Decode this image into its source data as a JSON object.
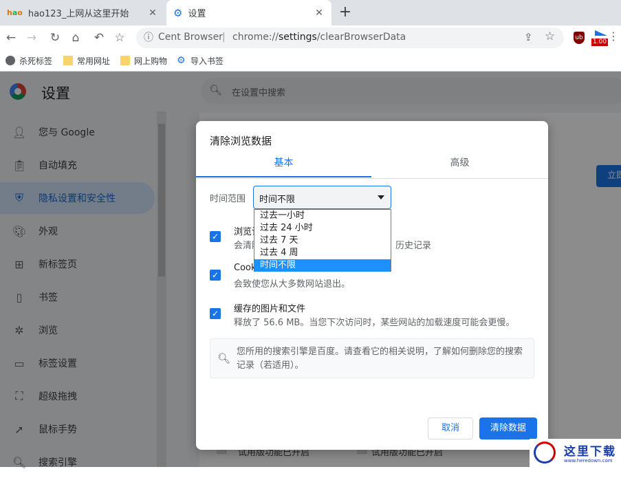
{
  "tabs": [
    {
      "title": "hao123_上网从这里开始",
      "icon": "hao123-favicon"
    },
    {
      "title": "设置",
      "icon": "gear-icon"
    }
  ],
  "toolbar": {
    "brand": "Cent Browser",
    "separator": "|",
    "url_prefix": "chrome://",
    "url_host": "settings",
    "url_path": "/clearBrowserData",
    "extension_badge": "1.00"
  },
  "bookmarks": [
    {
      "label": "杀死标签",
      "icon": "kill-tab-icon"
    },
    {
      "label": "常用网址",
      "icon": "folder-icon"
    },
    {
      "label": "网上购物",
      "icon": "folder-icon"
    },
    {
      "label": "导入书签",
      "icon": "gear-icon"
    }
  ],
  "settings": {
    "title": "设置",
    "search_placeholder": "在设置中搜索",
    "nav": [
      {
        "label": "您与 Google",
        "icon": "person-icon"
      },
      {
        "label": "自动填充",
        "icon": "clipboard-icon"
      },
      {
        "label": "隐私设置和安全性",
        "icon": "shield-icon",
        "active": true
      },
      {
        "label": "外观",
        "icon": "palette-icon"
      },
      {
        "label": "新标签页",
        "icon": "new-tab-icon"
      },
      {
        "label": "书签",
        "icon": "bookmark-icon"
      },
      {
        "label": "浏览",
        "icon": "browse-icon"
      },
      {
        "label": "标签设置",
        "icon": "tab-settings-icon"
      },
      {
        "label": "超级拖拽",
        "icon": "drag-icon"
      },
      {
        "label": "鼠标手势",
        "icon": "mouse-gesture-icon"
      },
      {
        "label": "搜索引擎",
        "icon": "search-icon"
      }
    ],
    "background_button": "立即",
    "background_row_1": "试用版功能已开启",
    "background_row_2": "试用版功能已开启"
  },
  "dialog": {
    "title": "清除浏览数据",
    "tab_basic": "基本",
    "tab_advanced": "高级",
    "time_range_label": "时间范围",
    "time_range_value": "时间不限",
    "time_options": [
      "过去一小时",
      "过去 24 小时",
      "过去 7 天",
      "过去 4 周",
      "时间不限"
    ],
    "selected_option": "时间不限",
    "items": [
      {
        "title": "浏览记",
        "desc": "会清除",
        "desc_tail": "历史记录",
        "checked": true
      },
      {
        "title": "Cook",
        "desc": "会致使您从大多数网站退出。",
        "checked": true
      },
      {
        "title": "缓存的图片和文件",
        "desc": "释放了 56.6 MB。当您下次访问时，某些网站的加载速度可能会更慢。",
        "checked": true
      }
    ],
    "info_text": "您所用的搜索引擎是百度。请查看它的相关说明，了解如何删除您的搜索记录（若适用）。",
    "cancel_label": "取消",
    "clear_label": "清除数据"
  },
  "watermark": {
    "text": "这里下载",
    "url": "www.heredown.com"
  },
  "colors": {
    "accent": "#1a73e8",
    "tabstrip": "#dee1e6",
    "overlay": "rgba(0,0,0,0.45)"
  }
}
